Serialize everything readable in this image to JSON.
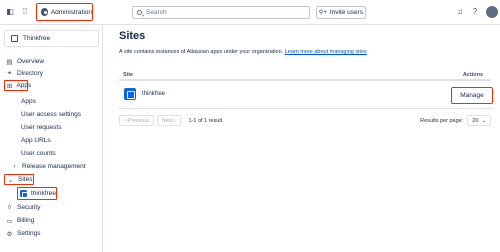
{
  "topbar": {
    "admin_label": "Administration",
    "search_placeholder": "Search",
    "invite_label": "Invite users"
  },
  "sidebar": {
    "org_name": "Thinkfree",
    "items": [
      {
        "label": "Overview",
        "icon": "overview-icon"
      },
      {
        "label": "Directory",
        "icon": "people-icon"
      },
      {
        "label": "Apps",
        "icon": "apps-icon"
      },
      {
        "label": "Apps"
      },
      {
        "label": "User access settings"
      },
      {
        "label": "User requests"
      },
      {
        "label": "App URLs"
      },
      {
        "label": "User counts"
      },
      {
        "label": "Release management"
      },
      {
        "label": "Sites"
      },
      {
        "label": "thinkfree"
      },
      {
        "label": "Security",
        "icon": "shield-icon"
      },
      {
        "label": "Billing",
        "icon": "billing-icon"
      },
      {
        "label": "Settings",
        "icon": "gear-icon"
      }
    ]
  },
  "main": {
    "title": "Sites",
    "description": "A site contains instances of Atlassian apps under your organization.",
    "learn_more": "Learn more about managing sites",
    "table": {
      "col_site": "Site",
      "col_actions": "Actions",
      "rows": [
        {
          "name": "thinkfree",
          "action": "Manage"
        }
      ]
    },
    "pagination": {
      "previous": "Previous",
      "next": "Next",
      "info": "1-1 of 1 result",
      "rpp_label": "Results per page:",
      "rpp_value": "20"
    }
  },
  "colors": {
    "highlight": "#de350b",
    "brand_blue": "#0c66e4",
    "link": "#0052cc"
  }
}
